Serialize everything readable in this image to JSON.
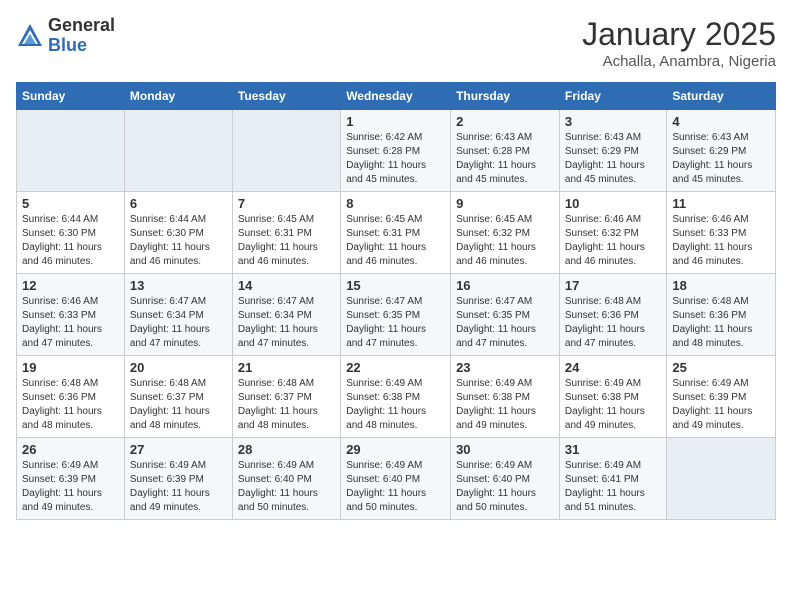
{
  "header": {
    "logo_general": "General",
    "logo_blue": "Blue",
    "month": "January 2025",
    "location": "Achalla, Anambra, Nigeria"
  },
  "days_of_week": [
    "Sunday",
    "Monday",
    "Tuesday",
    "Wednesday",
    "Thursday",
    "Friday",
    "Saturday"
  ],
  "weeks": [
    [
      {
        "num": "",
        "info": ""
      },
      {
        "num": "",
        "info": ""
      },
      {
        "num": "",
        "info": ""
      },
      {
        "num": "1",
        "info": "Sunrise: 6:42 AM\nSunset: 6:28 PM\nDaylight: 11 hours and 45 minutes."
      },
      {
        "num": "2",
        "info": "Sunrise: 6:43 AM\nSunset: 6:28 PM\nDaylight: 11 hours and 45 minutes."
      },
      {
        "num": "3",
        "info": "Sunrise: 6:43 AM\nSunset: 6:29 PM\nDaylight: 11 hours and 45 minutes."
      },
      {
        "num": "4",
        "info": "Sunrise: 6:43 AM\nSunset: 6:29 PM\nDaylight: 11 hours and 45 minutes."
      }
    ],
    [
      {
        "num": "5",
        "info": "Sunrise: 6:44 AM\nSunset: 6:30 PM\nDaylight: 11 hours and 46 minutes."
      },
      {
        "num": "6",
        "info": "Sunrise: 6:44 AM\nSunset: 6:30 PM\nDaylight: 11 hours and 46 minutes."
      },
      {
        "num": "7",
        "info": "Sunrise: 6:45 AM\nSunset: 6:31 PM\nDaylight: 11 hours and 46 minutes."
      },
      {
        "num": "8",
        "info": "Sunrise: 6:45 AM\nSunset: 6:31 PM\nDaylight: 11 hours and 46 minutes."
      },
      {
        "num": "9",
        "info": "Sunrise: 6:45 AM\nSunset: 6:32 PM\nDaylight: 11 hours and 46 minutes."
      },
      {
        "num": "10",
        "info": "Sunrise: 6:46 AM\nSunset: 6:32 PM\nDaylight: 11 hours and 46 minutes."
      },
      {
        "num": "11",
        "info": "Sunrise: 6:46 AM\nSunset: 6:33 PM\nDaylight: 11 hours and 46 minutes."
      }
    ],
    [
      {
        "num": "12",
        "info": "Sunrise: 6:46 AM\nSunset: 6:33 PM\nDaylight: 11 hours and 47 minutes."
      },
      {
        "num": "13",
        "info": "Sunrise: 6:47 AM\nSunset: 6:34 PM\nDaylight: 11 hours and 47 minutes."
      },
      {
        "num": "14",
        "info": "Sunrise: 6:47 AM\nSunset: 6:34 PM\nDaylight: 11 hours and 47 minutes."
      },
      {
        "num": "15",
        "info": "Sunrise: 6:47 AM\nSunset: 6:35 PM\nDaylight: 11 hours and 47 minutes."
      },
      {
        "num": "16",
        "info": "Sunrise: 6:47 AM\nSunset: 6:35 PM\nDaylight: 11 hours and 47 minutes."
      },
      {
        "num": "17",
        "info": "Sunrise: 6:48 AM\nSunset: 6:36 PM\nDaylight: 11 hours and 47 minutes."
      },
      {
        "num": "18",
        "info": "Sunrise: 6:48 AM\nSunset: 6:36 PM\nDaylight: 11 hours and 48 minutes."
      }
    ],
    [
      {
        "num": "19",
        "info": "Sunrise: 6:48 AM\nSunset: 6:36 PM\nDaylight: 11 hours and 48 minutes."
      },
      {
        "num": "20",
        "info": "Sunrise: 6:48 AM\nSunset: 6:37 PM\nDaylight: 11 hours and 48 minutes."
      },
      {
        "num": "21",
        "info": "Sunrise: 6:48 AM\nSunset: 6:37 PM\nDaylight: 11 hours and 48 minutes."
      },
      {
        "num": "22",
        "info": "Sunrise: 6:49 AM\nSunset: 6:38 PM\nDaylight: 11 hours and 48 minutes."
      },
      {
        "num": "23",
        "info": "Sunrise: 6:49 AM\nSunset: 6:38 PM\nDaylight: 11 hours and 49 minutes."
      },
      {
        "num": "24",
        "info": "Sunrise: 6:49 AM\nSunset: 6:38 PM\nDaylight: 11 hours and 49 minutes."
      },
      {
        "num": "25",
        "info": "Sunrise: 6:49 AM\nSunset: 6:39 PM\nDaylight: 11 hours and 49 minutes."
      }
    ],
    [
      {
        "num": "26",
        "info": "Sunrise: 6:49 AM\nSunset: 6:39 PM\nDaylight: 11 hours and 49 minutes."
      },
      {
        "num": "27",
        "info": "Sunrise: 6:49 AM\nSunset: 6:39 PM\nDaylight: 11 hours and 49 minutes."
      },
      {
        "num": "28",
        "info": "Sunrise: 6:49 AM\nSunset: 6:40 PM\nDaylight: 11 hours and 50 minutes."
      },
      {
        "num": "29",
        "info": "Sunrise: 6:49 AM\nSunset: 6:40 PM\nDaylight: 11 hours and 50 minutes."
      },
      {
        "num": "30",
        "info": "Sunrise: 6:49 AM\nSunset: 6:40 PM\nDaylight: 11 hours and 50 minutes."
      },
      {
        "num": "31",
        "info": "Sunrise: 6:49 AM\nSunset: 6:41 PM\nDaylight: 11 hours and 51 minutes."
      },
      {
        "num": "",
        "info": ""
      }
    ]
  ]
}
